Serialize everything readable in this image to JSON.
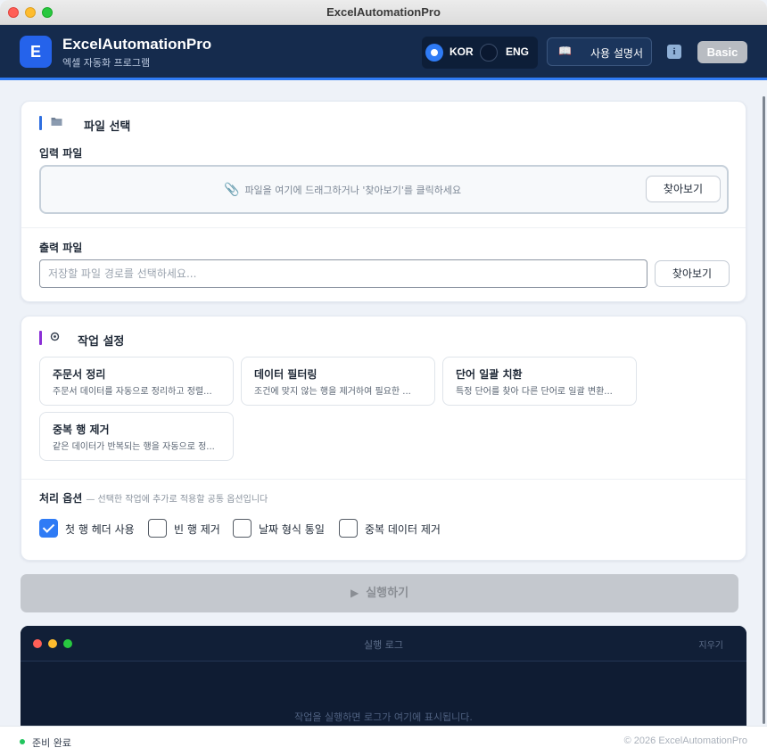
{
  "window": {
    "title": "ExcelAutomationPro"
  },
  "header": {
    "logo_letter": "E",
    "app_name": "ExcelAutomationPro",
    "subtitle": "엑셀 자동화 프로그램",
    "lang_kor": "KOR",
    "lang_eng": "ENG",
    "selected_lang": "KOR",
    "manual_icon": "book-icon",
    "manual_label": "사용 설명서",
    "info_icon": "i",
    "plan_badge": "Basic"
  },
  "file_section": {
    "icon": "folder-icon",
    "title": "파일 선택",
    "input_label": "입력 파일",
    "drop_text": "파일을 여기에 드래그하거나 '찾아보기'를 클릭하세요",
    "browse_label": "찾아보기",
    "output_label": "출력 파일",
    "output_placeholder": "저장할 파일 경로를 선택하세요...",
    "output_value": ""
  },
  "task_section": {
    "icon": "gear-icon",
    "title": "작업 설정",
    "tasks": [
      {
        "title": "주문서 정리",
        "desc": "주문서 데이터를 자동으로 정리하고 정렬..."
      },
      {
        "title": "데이터 필터링",
        "desc": "조건에 맞지 않는 행을 제거하여 필요한 ..."
      },
      {
        "title": "단어 일괄 치환",
        "desc": "특정 단어를 찾아 다른 단어로 일괄 변환..."
      },
      {
        "title": "중복 행 제거",
        "desc": "같은 데이터가 반복되는 행을 자동으로 정..."
      }
    ],
    "options_label": "처리 옵션",
    "options_hint": "— 선택한 작업에 추가로 적용할 공통 옵션입니다",
    "options": [
      {
        "label": "첫 행 헤더 사용",
        "checked": true
      },
      {
        "label": "빈 행 제거",
        "checked": false
      },
      {
        "label": "날짜 형식 통일",
        "checked": false
      },
      {
        "label": "중복 데이터 제거",
        "checked": false
      }
    ]
  },
  "run": {
    "icon": "play-icon",
    "label": "실행하기",
    "enabled": false
  },
  "log": {
    "title": "실행 로그",
    "clear_label": "지우기",
    "empty_text": "작업을 실행하면 로그가 여기에 표시됩니다."
  },
  "status": {
    "text": "준비 완료",
    "color": "#22c55e",
    "copyright": "© 2026 ExcelAutomationPro"
  },
  "colors": {
    "accent": "#2f7bf5",
    "header_bg": "#152b4d",
    "log_bg": "#0f1c33"
  }
}
